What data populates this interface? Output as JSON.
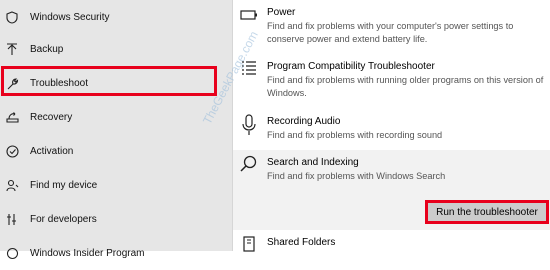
{
  "sidebar": {
    "items": [
      {
        "label": "Windows Security",
        "icon": "shield-icon"
      },
      {
        "label": "Backup",
        "icon": "arrow-up-icon"
      },
      {
        "label": "Troubleshoot",
        "icon": "wrench-icon"
      },
      {
        "label": "Recovery",
        "icon": "recovery-icon"
      },
      {
        "label": "Activation",
        "icon": "checkmark-circle-icon"
      },
      {
        "label": "Find my device",
        "icon": "person-location-icon"
      },
      {
        "label": "For developers",
        "icon": "developer-tools-icon"
      },
      {
        "label": "Windows Insider Program",
        "icon": "insider-icon"
      }
    ],
    "selected": "Troubleshoot"
  },
  "troubleshooters": [
    {
      "title": "Power",
      "description": "Find and fix problems with your computer's power settings to conserve power and extend battery life.",
      "icon": "battery-icon"
    },
    {
      "title": "Program Compatibility Troubleshooter",
      "description": "Find and fix problems with running older programs on this version of Windows.",
      "icon": "list-icon"
    },
    {
      "title": "Recording Audio",
      "description": "Find and fix problems with recording sound",
      "icon": "microphone-icon"
    },
    {
      "title": "Search and Indexing",
      "description": "Find and fix problems with Windows Search",
      "icon": "search-icon"
    },
    {
      "title": "Shared Folders",
      "description": "",
      "icon": "folder-icon"
    }
  ],
  "run_button_label": "Run the troubleshooter",
  "watermark_text": "TheGeekPage.com",
  "colors": {
    "highlight_border": "#e8001c",
    "sidebar_bg": "#e6e6e6",
    "button_bg": "#cccccc"
  }
}
